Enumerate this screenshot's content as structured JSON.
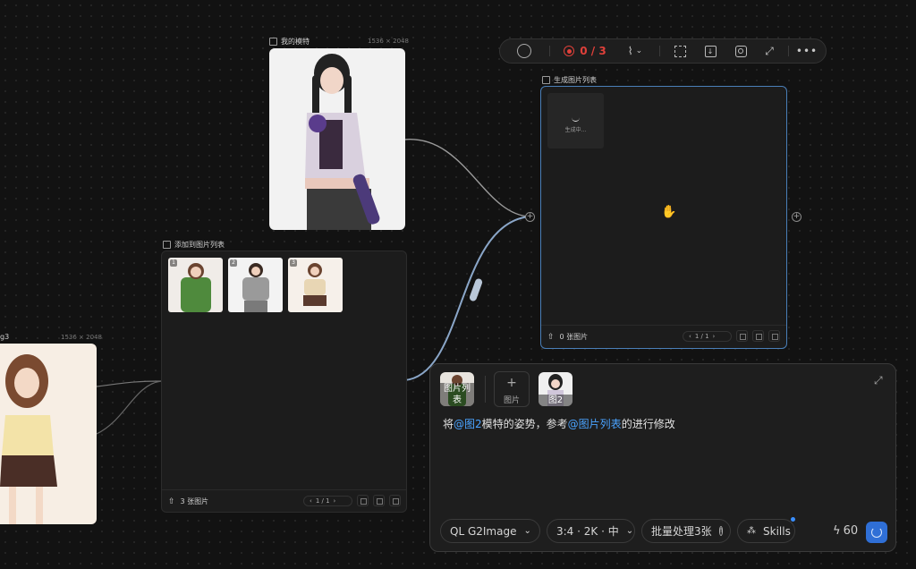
{
  "canvas": {
    "toolbar": {
      "record_count": "0 / 3",
      "accent": "#e0403a"
    },
    "model_node": {
      "title": "我的模特",
      "dimensions": "1536 × 2048"
    },
    "left_node": {
      "title_fragment": "g3",
      "dimensions": "1536 × 2048"
    },
    "image_list_node": {
      "title": "添加到图片列表",
      "thumbnails": [
        {
          "index": "1",
          "color": "#4f8a3d"
        },
        {
          "index": "2",
          "color": "#9a9a9a"
        },
        {
          "index": "3",
          "color": "#e8d6b4"
        }
      ],
      "count_label": "3 张图片",
      "pager": "1 / 1"
    },
    "generated_node": {
      "title": "生成图片列表",
      "generating_label": "生成中...",
      "count_label": "0 张图片",
      "pager": "1 / 1"
    }
  },
  "prompt": {
    "refs": [
      {
        "label": "图片列表",
        "icon": "image-list-ref-icon"
      },
      {
        "label": "图片",
        "icon": "add-image-icon"
      },
      {
        "label": "图2",
        "icon": "model-ref-icon"
      }
    ],
    "text_parts": [
      {
        "text": "将",
        "mention": false
      },
      {
        "text": "@图2",
        "mention": true
      },
      {
        "text": "模特的姿势，参考",
        "mention": false
      },
      {
        "text": "@图片列表",
        "mention": true
      },
      {
        "text": "的进行修改",
        "mention": false
      }
    ],
    "model_select": "QL G2Image",
    "params_select": "3:4 · 2K · 中",
    "batch_label": "批量处理3张",
    "skills_label": "Skills",
    "credits": "60",
    "accent": "#2f6fd6"
  }
}
